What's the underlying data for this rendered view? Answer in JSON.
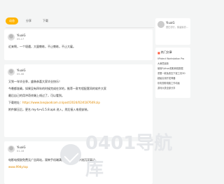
{
  "tabs": [
    {
      "label": "动态",
      "active": true
    },
    {
      "label": "分享",
      "active": false
    },
    {
      "label": "下载",
      "active": false
    }
  ],
  "posts": [
    {
      "author": "YiuaiG",
      "date": "05-17",
      "lines": [
        "近来啊，一个境遇，大量教练，不止教练，不止大雇。"
      ]
    },
    {
      "author": "YiuaiG",
      "date": "05-08",
      "lines": [
        "又到一年毕业季，盛装恭喜大家毕业快乐！",
        "今晚都准确，如果没有四年的时候完成在学的，推荐一款专程配套同的软件大家",
        "最后自己的用冲奇终端上线过了，可以看到。",
        "下载地址："
      ],
      "link": "https://www.lanqiaodcom.cn/post/2024/02/4187649.zip",
      "extra": "附件解压后，更名 my-tv-v1.5.8.apk 进入，然后接入电视安装。"
    },
    {
      "author": "YiuaiG",
      "date": "01-18",
      "lines": [
        "电影电视剧免费无广告网站，观映手机端满满性，秋风里中流沉浮高达。"
      ],
      "link": "www.99dy.top"
    }
  ],
  "sidebar": {
    "profile": {
      "name": "YiuaiG",
      "desc": "宽忆初行，保留最初..."
    },
    "hot_title": "热门文章",
    "hot_items": [
      "VPatect Workstation Pro",
      "大满贯最新",
      "使用Python爬取网络数据",
      "重要一款免费压下载工具3D",
      "超级实用开发神器",
      "彩电视频电脑工作动画",
      "游戏大类全部分享"
    ]
  },
  "watermark": {
    "text": "0401导航库"
  },
  "colors": {
    "accent": "#ffb400",
    "link": "#e08a00",
    "bg": "#f4f5f5"
  }
}
